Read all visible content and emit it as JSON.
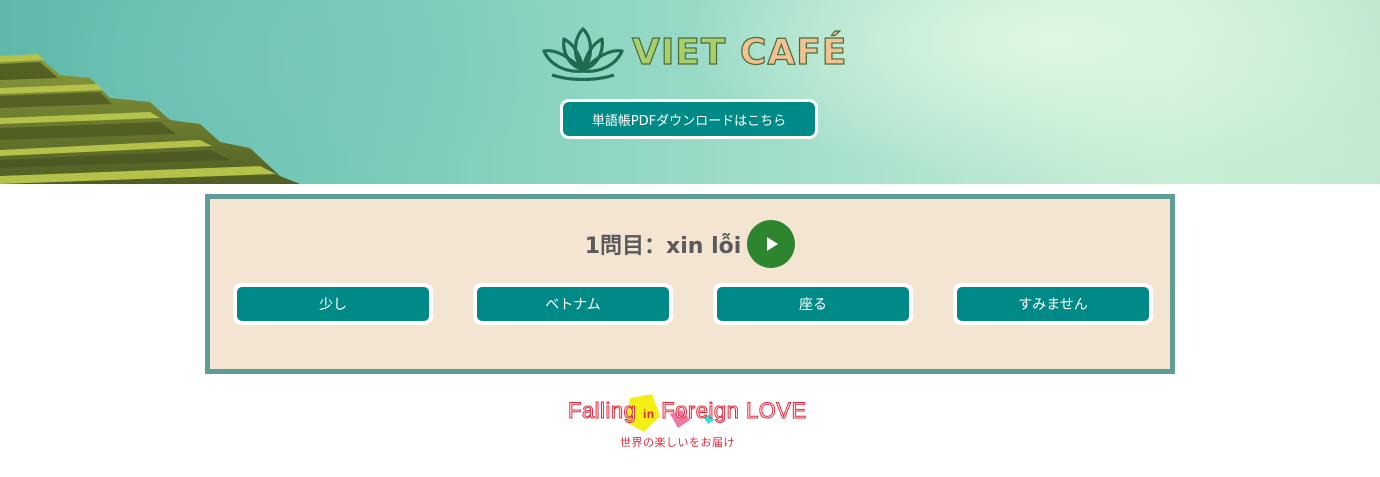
{
  "header": {
    "logo": {
      "word1": "VIET",
      "word2": "CAFÉ"
    },
    "download_button": "単語帳PDFダウンロードはこちら"
  },
  "quiz": {
    "question": "1問目：xin lỗi",
    "play_icon": "play-icon",
    "answers": [
      "少し",
      "ベトナム",
      "座る",
      "すみません"
    ]
  },
  "footer": {
    "brand_falling": "Falling",
    "brand_in": "in",
    "brand_foreign": "Foreign",
    "brand_love": "LOVE",
    "tagline": "世界の楽しいをお届け"
  },
  "colors": {
    "accent_teal": "#008a87",
    "play_green": "#2e8530",
    "quiz_bg": "#f4e4d2",
    "quiz_border": "#5f9c98",
    "brand_red": "#e8283a"
  }
}
